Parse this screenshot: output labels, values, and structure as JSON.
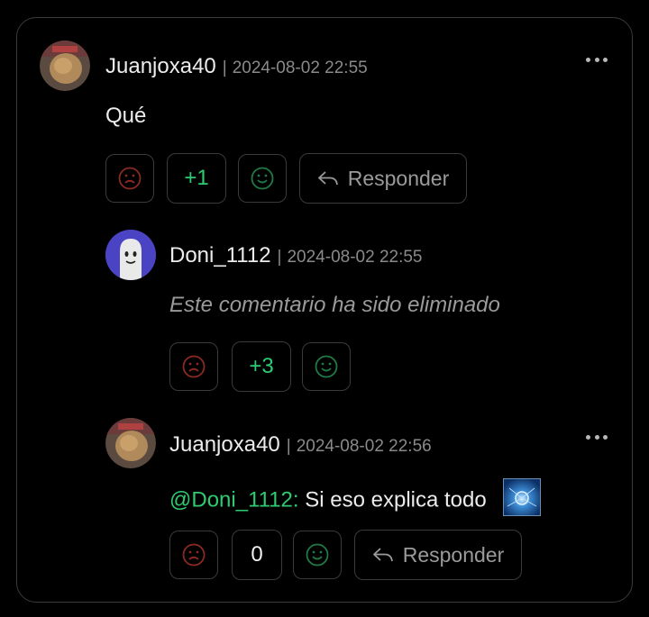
{
  "comments": [
    {
      "username": "Juanjoxa40",
      "separator": "|",
      "date": "2024-08-02 22:55",
      "text": "Qué",
      "score": "+1",
      "reply_label": "Responder"
    },
    {
      "username": "Doni_1112",
      "separator": "|",
      "date": "2024-08-02 22:55",
      "text": "Este comentario ha sido eliminado",
      "score": "+3"
    },
    {
      "username": "Juanjoxa40",
      "separator": "|",
      "date": "2024-08-02 22:56",
      "mention": "@Doni_1112:",
      "text": "Si eso explica todo",
      "score": "0",
      "reply_label": "Responder"
    }
  ],
  "colors": {
    "accent_green": "#2ecc71",
    "downvote_red": "#8a2a22",
    "upvote_green": "#1f7a45",
    "border": "#3a3a3a",
    "ghost_avatar_bg": "#4a44c4"
  },
  "icons": {
    "downvote": "sad-face-icon",
    "upvote": "smile-face-icon",
    "reply": "reply-arrow-icon",
    "more": "more-dots-icon"
  }
}
